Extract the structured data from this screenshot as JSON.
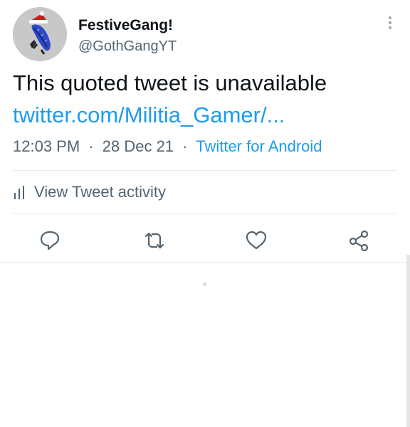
{
  "tweet": {
    "display_name": "FestiveGang!",
    "handle": "@GothGangYT",
    "text": "This quoted tweet is unavailable",
    "link_text": "twitter.com/Militia_Gamer/...",
    "time": "12:03 PM",
    "date": "28 Dec 21",
    "separator": "·",
    "source": "Twitter for Android"
  },
  "activity": {
    "label": "View Tweet activity"
  },
  "icons": {
    "more": "more-vertical-icon",
    "activity": "bar-chart-icon",
    "reply": "reply-icon",
    "retweet": "retweet-icon",
    "like": "heart-icon",
    "share": "share-icon"
  },
  "colors": {
    "link": "#1d9bf0",
    "text": "#0f1419",
    "muted": "#536471",
    "divider": "#e6ecf0"
  }
}
